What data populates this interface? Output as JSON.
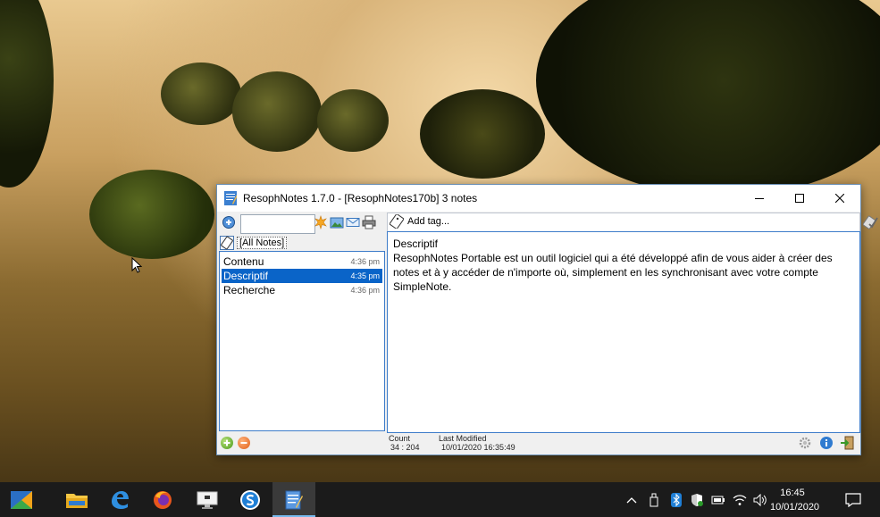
{
  "window": {
    "title": "ResophNotes 1.7.0 - [ResophNotes170b] 3 notes",
    "minimize_icon": "minimize-icon",
    "maximize_icon": "maximize-icon",
    "close_icon": "close-icon"
  },
  "toolbar": {
    "search_value": "",
    "tag_placeholder": "Add tag..."
  },
  "filter": {
    "label": "[All Notes]"
  },
  "notes": [
    {
      "title": "Contenu",
      "time": "4:36 pm",
      "selected": false
    },
    {
      "title": "Descriptif",
      "time": "4:35 pm",
      "selected": true
    },
    {
      "title": "Recherche",
      "time": "4:36 pm",
      "selected": false
    }
  ],
  "editor": {
    "title_line": "Descriptif",
    "body": "ResophNotes Portable est un outil logiciel qui a été développé afin de vous aider à créer des notes et à y accéder de n'importe où, simplement en les synchronisant avec votre compte SimpleNote."
  },
  "status": {
    "count_label": "Count",
    "count_value": "34 : 204",
    "modified_label": "Last Modified",
    "modified_value": "10/01/2020 16:35:49"
  },
  "taskbar": {
    "time": "16:45",
    "date": "10/01/2020"
  },
  "colors": {
    "selection": "#0a64c8",
    "taskbar": "#1b1b1b",
    "accent": "#76b9ed"
  }
}
